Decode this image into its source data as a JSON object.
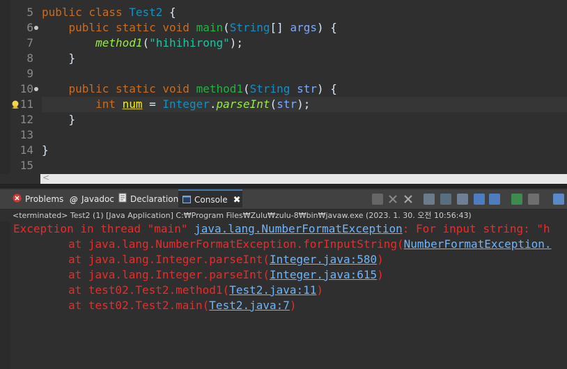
{
  "editor": {
    "line_numbers": [
      "5",
      "6",
      "7",
      "8",
      "9",
      "10",
      "11",
      "12",
      "13",
      "14",
      "15"
    ],
    "lines": {
      "l5": {
        "kw": "public class ",
        "cls": "Test2",
        "rest": " {"
      },
      "l6": {
        "kw": "public static void ",
        "mth": "main",
        "p1": "(",
        "cls": "String",
        "p2": "[] ",
        "var": "args",
        "p3": ") {"
      },
      "l7": {
        "mi": "method1",
        "p1": "(",
        "str": "\"hihihirong\"",
        "p2": ");"
      },
      "l8": {
        "t": "}"
      },
      "l10": {
        "kw": "public static void ",
        "mth": "method1",
        "p1": "(",
        "cls": "String",
        "p2": " ",
        "var": "str",
        "p3": ") {"
      },
      "l11": {
        "kw": "int ",
        "warn": "num",
        "p1": " = ",
        "cls": "Integer",
        "p2": ".",
        "smi": "parseInt",
        "p3": "(",
        "var": "str",
        "p4": ");"
      },
      "l12": {
        "t": "}"
      },
      "l14": {
        "t": "}"
      }
    },
    "scroll_arrow": "<"
  },
  "view": {
    "tabs": [
      {
        "label": "Problems",
        "icon": "problems-icon"
      },
      {
        "label": "Javadoc",
        "icon": "javadoc-icon"
      },
      {
        "label": "Declaration",
        "icon": "declaration-icon"
      },
      {
        "label": "Console",
        "icon": "console-icon",
        "active": true
      }
    ],
    "close_glyph": "✖"
  },
  "console": {
    "status": "<terminated> Test2 (1) [Java Application] C:₩Program Files₩Zulu₩zulu-8₩bin₩javaw.exe (2023. 1. 30. 오전 10:56:43)",
    "exception": {
      "prefix": "Exception in thread \"main\" ",
      "link": "java.lang.NumberFormatException",
      "suffix": ": For input string: \"h"
    },
    "frames": [
      {
        "text": "\tat java.lang.NumberFormatException.forInputString(",
        "link": "NumberFormatException.",
        "end": ""
      },
      {
        "text": "\tat java.lang.Integer.parseInt(",
        "link": "Integer.java:580",
        "end": ")"
      },
      {
        "text": "\tat java.lang.Integer.parseInt(",
        "link": "Integer.java:615",
        "end": ")"
      },
      {
        "text": "\tat test02.Test2.method1(",
        "link": "Test2.java:11",
        "end": ")"
      },
      {
        "text": "\tat test02.Test2.main(",
        "link": "Test2.java:7",
        "end": ")"
      }
    ]
  },
  "colors": {
    "error": "#ef2929",
    "link": "#6db6ff",
    "keyword": "#cc6c1d",
    "active_tab_border": "#3f7db7"
  }
}
